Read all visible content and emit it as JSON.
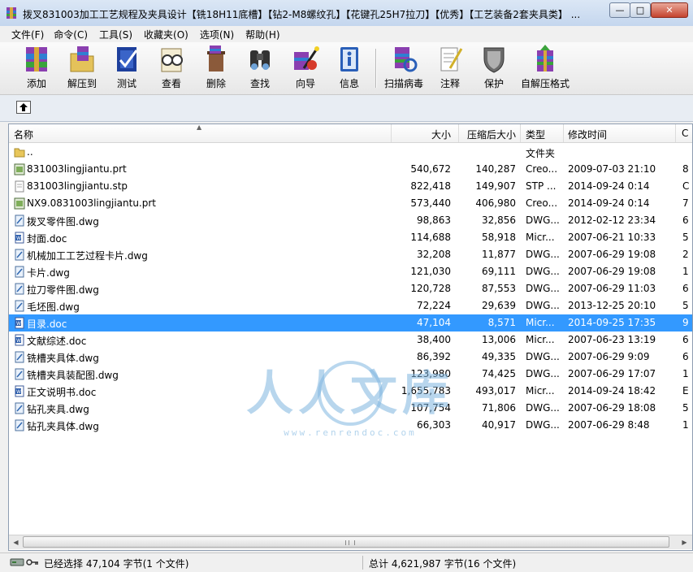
{
  "window": {
    "title": "拨叉831003加工工艺规程及夹具设计【铣18H11底槽】【钻2-M8螺纹孔】【花键孔25H7拉刀】【优秀】【工艺装备2套夹具类】 ...",
    "minimize": "—",
    "maximize": "□",
    "close": "✕"
  },
  "menu": [
    "文件(F)",
    "命令(C)",
    "工具(S)",
    "收藏夹(O)",
    "选项(N)",
    "帮助(H)"
  ],
  "toolbar": {
    "add": "添加",
    "extract": "解压到",
    "test": "测试",
    "view": "查看",
    "delete": "删除",
    "find": "查找",
    "wizard": "向导",
    "info": "信息",
    "virus_scan": "扫描病毒",
    "comment": "注释",
    "protect": "保护",
    "sfx": "自解压格式"
  },
  "columns": {
    "name": "名称",
    "size": "大小",
    "packed": "压缩后大小",
    "type": "类型",
    "modified": "修改时间",
    "crc": "C"
  },
  "files": [
    {
      "icon": "folder-icon",
      "name": "..",
      "size": "",
      "packed": "",
      "type": "文件夹",
      "modified": "",
      "crc": ""
    },
    {
      "icon": "prt-file-icon",
      "name": "831003lingjiantu.prt",
      "size": "540,672",
      "packed": "140,287",
      "type": "Creo...",
      "modified": "2009-07-03 21:10",
      "crc": "8"
    },
    {
      "icon": "stp-file-icon",
      "name": "831003lingjiantu.stp",
      "size": "822,418",
      "packed": "149,907",
      "type": "STP ...",
      "modified": "2014-09-24 0:14",
      "crc": "C"
    },
    {
      "icon": "prt-file-icon",
      "name": "NX9.0831003lingjiantu.prt",
      "size": "573,440",
      "packed": "406,980",
      "type": "Creo...",
      "modified": "2014-09-24 0:14",
      "crc": "7"
    },
    {
      "icon": "dwg-file-icon",
      "name": "拨叉零件图.dwg",
      "size": "98,863",
      "packed": "32,856",
      "type": "DWG...",
      "modified": "2012-02-12 23:34",
      "crc": "6"
    },
    {
      "icon": "doc-file-icon",
      "name": "封面.doc",
      "size": "114,688",
      "packed": "58,918",
      "type": "Micr...",
      "modified": "2007-06-21 10:33",
      "crc": "5"
    },
    {
      "icon": "dwg-file-icon",
      "name": "机械加工工艺过程卡片.dwg",
      "size": "32,208",
      "packed": "11,877",
      "type": "DWG...",
      "modified": "2007-06-29 19:08",
      "crc": "2"
    },
    {
      "icon": "dwg-file-icon",
      "name": "卡片.dwg",
      "size": "121,030",
      "packed": "69,111",
      "type": "DWG...",
      "modified": "2007-06-29 19:08",
      "crc": "1"
    },
    {
      "icon": "dwg-file-icon",
      "name": "拉刀零件图.dwg",
      "size": "120,728",
      "packed": "87,553",
      "type": "DWG...",
      "modified": "2007-06-29 11:03",
      "crc": "6"
    },
    {
      "icon": "dwg-file-icon",
      "name": "毛坯图.dwg",
      "size": "72,224",
      "packed": "29,639",
      "type": "DWG...",
      "modified": "2013-12-25 20:10",
      "crc": "5"
    },
    {
      "icon": "doc-file-icon",
      "name": "目录.doc",
      "size": "47,104",
      "packed": "8,571",
      "type": "Micr...",
      "modified": "2014-09-25 17:35",
      "crc": "9",
      "selected": true
    },
    {
      "icon": "doc-file-icon",
      "name": "文献综述.doc",
      "size": "38,400",
      "packed": "13,006",
      "type": "Micr...",
      "modified": "2007-06-23 13:19",
      "crc": "6"
    },
    {
      "icon": "dwg-file-icon",
      "name": "铣槽夹具体.dwg",
      "size": "86,392",
      "packed": "49,335",
      "type": "DWG...",
      "modified": "2007-06-29 9:09",
      "crc": "6"
    },
    {
      "icon": "dwg-file-icon",
      "name": "铣槽夹具装配图.dwg",
      "size": "123,980",
      "packed": "74,425",
      "type": "DWG...",
      "modified": "2007-06-29 17:07",
      "crc": "1"
    },
    {
      "icon": "doc-file-icon",
      "name": "正文说明书.doc",
      "size": "1,655,783",
      "packed": "493,017",
      "type": "Micr...",
      "modified": "2014-09-24 18:42",
      "crc": "E"
    },
    {
      "icon": "dwg-file-icon",
      "name": "钻孔夹具.dwg",
      "size": "107,754",
      "packed": "71,806",
      "type": "DWG...",
      "modified": "2007-06-29 18:08",
      "crc": "5"
    },
    {
      "icon": "dwg-file-icon",
      "name": "钻孔夹具体.dwg",
      "size": "66,303",
      "packed": "40,917",
      "type": "DWG...",
      "modified": "2007-06-29 8:48",
      "crc": "1"
    }
  ],
  "status": {
    "selected": "已经选择 47,104 字节(1 个文件)",
    "total": "总计 4,621,987 字节(16 个文件)"
  },
  "watermark": {
    "logo_text": "人人文库",
    "url_text": "www.renrendoc.com"
  },
  "colors": {
    "selection": "#3399ff",
    "watermark": "#7fb6e0"
  }
}
